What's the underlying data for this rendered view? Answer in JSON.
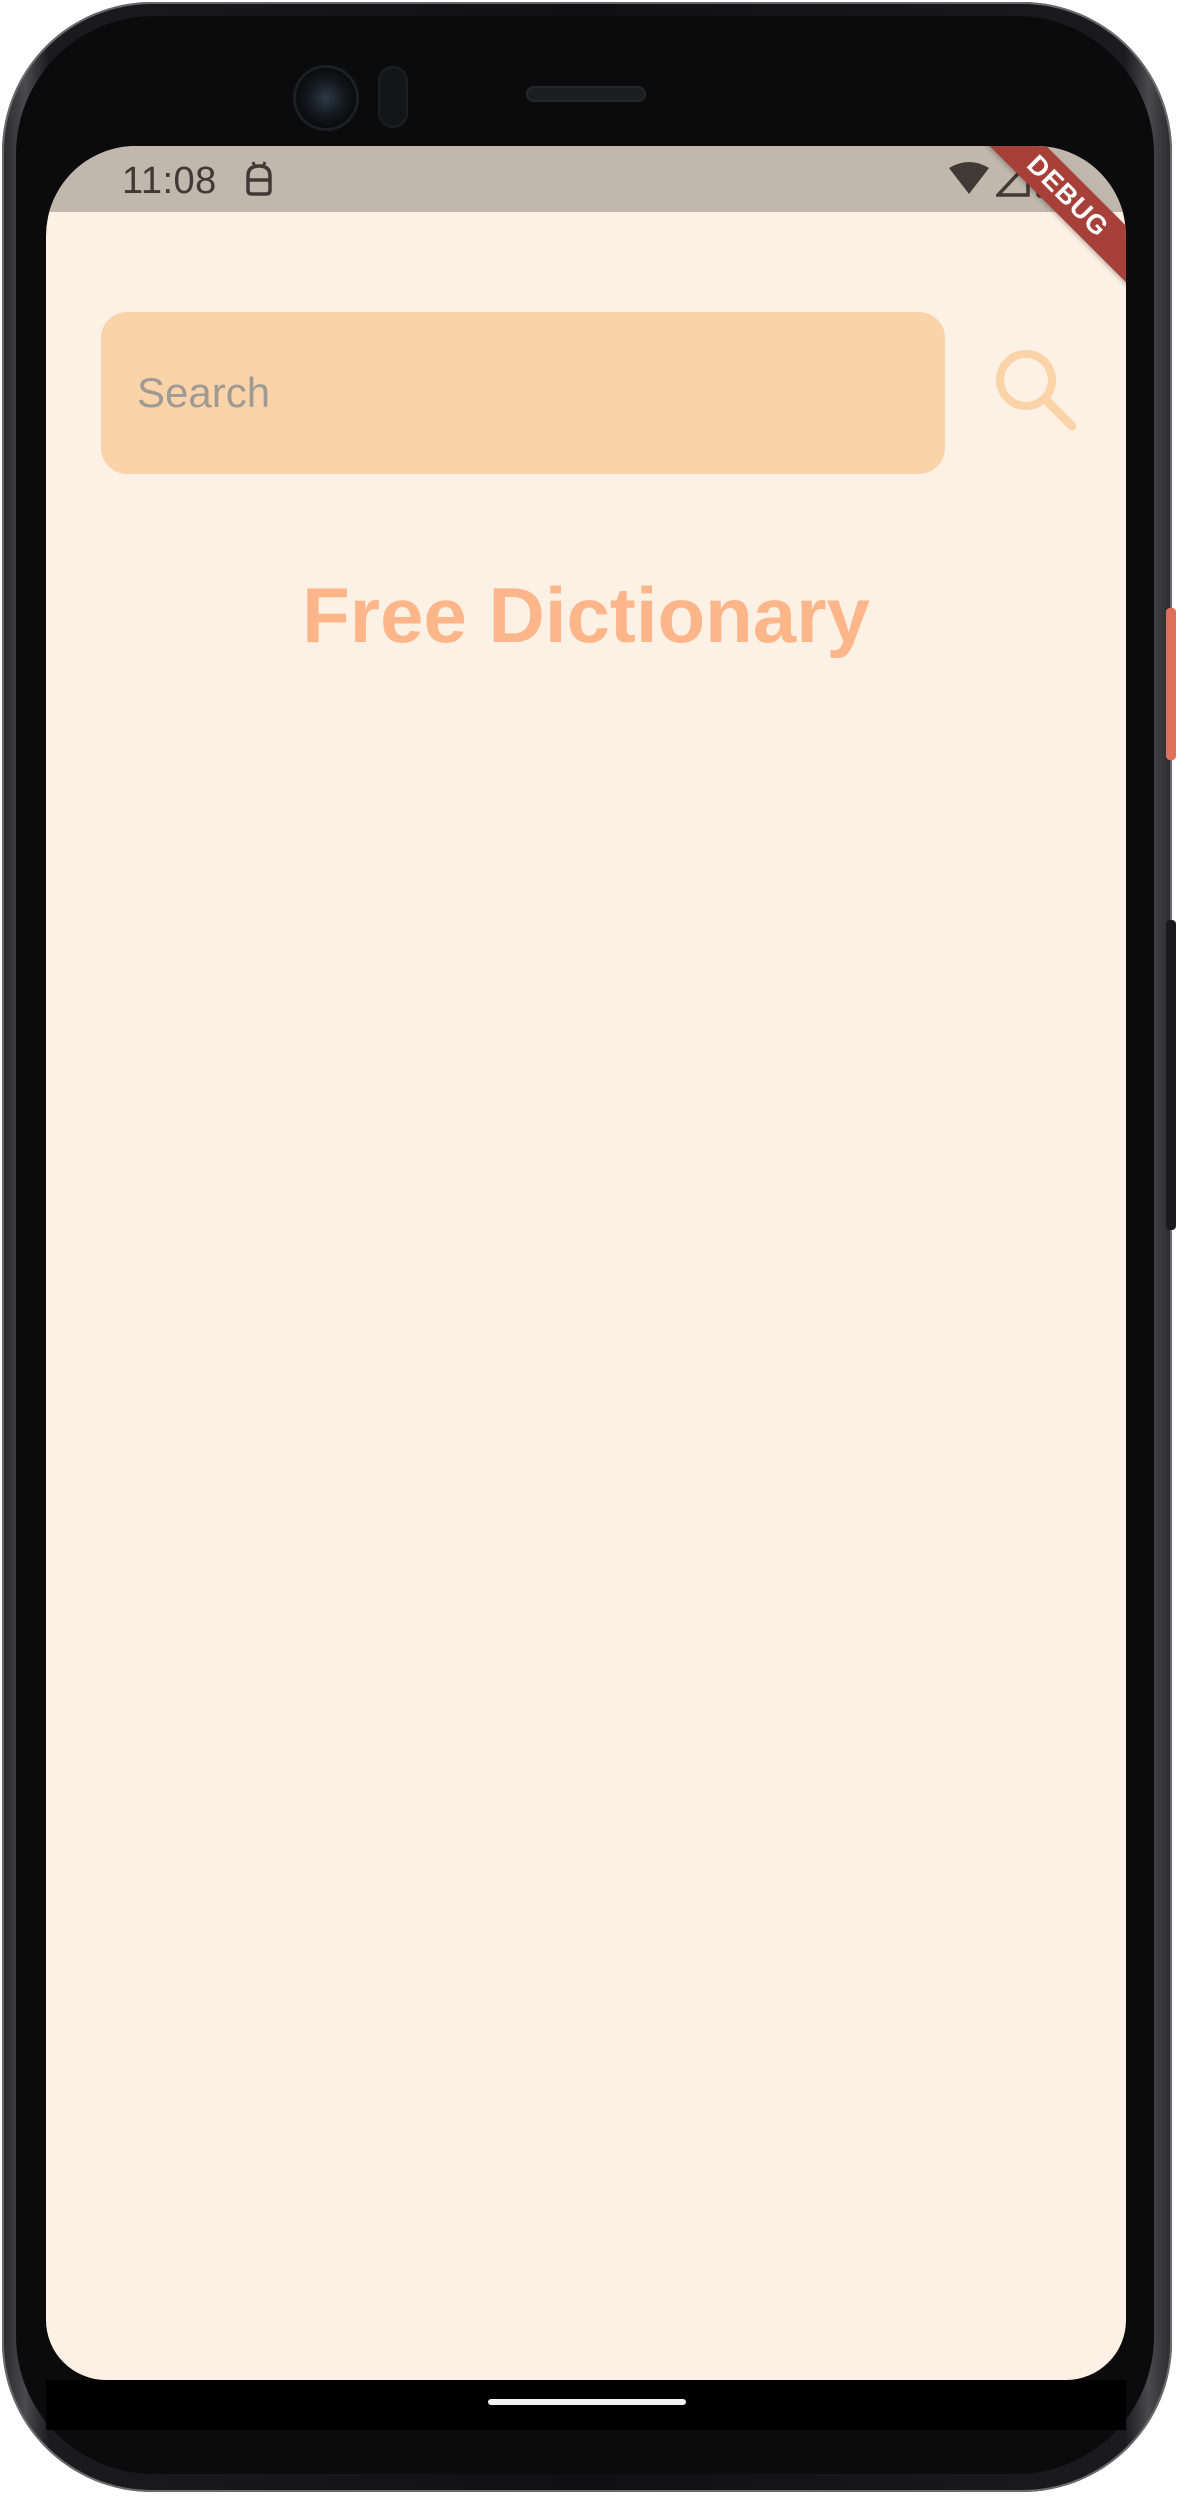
{
  "status_bar": {
    "time": "11:08"
  },
  "debug_banner": {
    "label": "DEBUG"
  },
  "search": {
    "placeholder": "Search",
    "value": ""
  },
  "app": {
    "title": "Free Dictionary"
  },
  "colors": {
    "background": "#fdf0e4",
    "status_bar": "#c2b7ad",
    "search_field": "#fad4a8",
    "search_icon": "#fad4a8",
    "title": "#fdb68a",
    "debug_ribbon": "#a8403a"
  },
  "icons": {
    "status_bot": "android-debug-icon",
    "wifi": "wifi-icon",
    "signal": "signal-icon",
    "battery": "battery-icon",
    "search": "search-icon"
  }
}
